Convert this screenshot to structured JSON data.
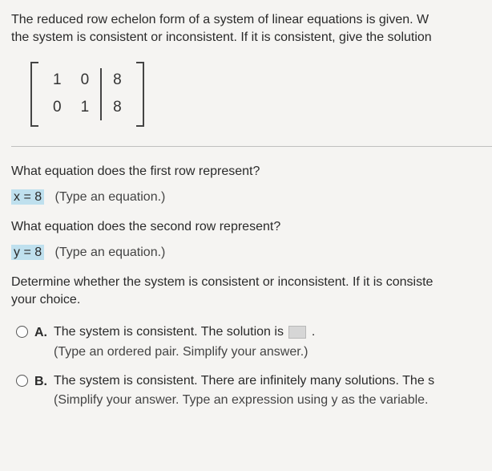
{
  "intro": {
    "line1": "The reduced row echelon form of a system of linear equations is given. W",
    "line2": "the system is consistent or inconsistent. If it is consistent, give the solution"
  },
  "matrix": {
    "r1c1": "1",
    "r1c2": "0",
    "r1c3": "8",
    "r2c1": "0",
    "r2c2": "1",
    "r2c3": "8"
  },
  "q1": "What equation does the first row represent?",
  "a1": {
    "value": "x = 8",
    "hint": "(Type an equation.)"
  },
  "q2": "What equation does the second row represent?",
  "a2": {
    "value": "y = 8",
    "hint": "(Type an equation.)"
  },
  "q3": {
    "line1": "Determine whether the system is consistent or inconsistent. If it is consiste",
    "line2": "your choice."
  },
  "choices": {
    "A": {
      "label": "A.",
      "text": "The system is consistent. The solution is ",
      "hint": "(Type an ordered pair. Simplify your answer.)"
    },
    "B": {
      "label": "B.",
      "text": "The system is consistent. There are infinitely many solutions. The s",
      "hint": "(Simplify your answer. Type an expression using y as the variable."
    }
  }
}
